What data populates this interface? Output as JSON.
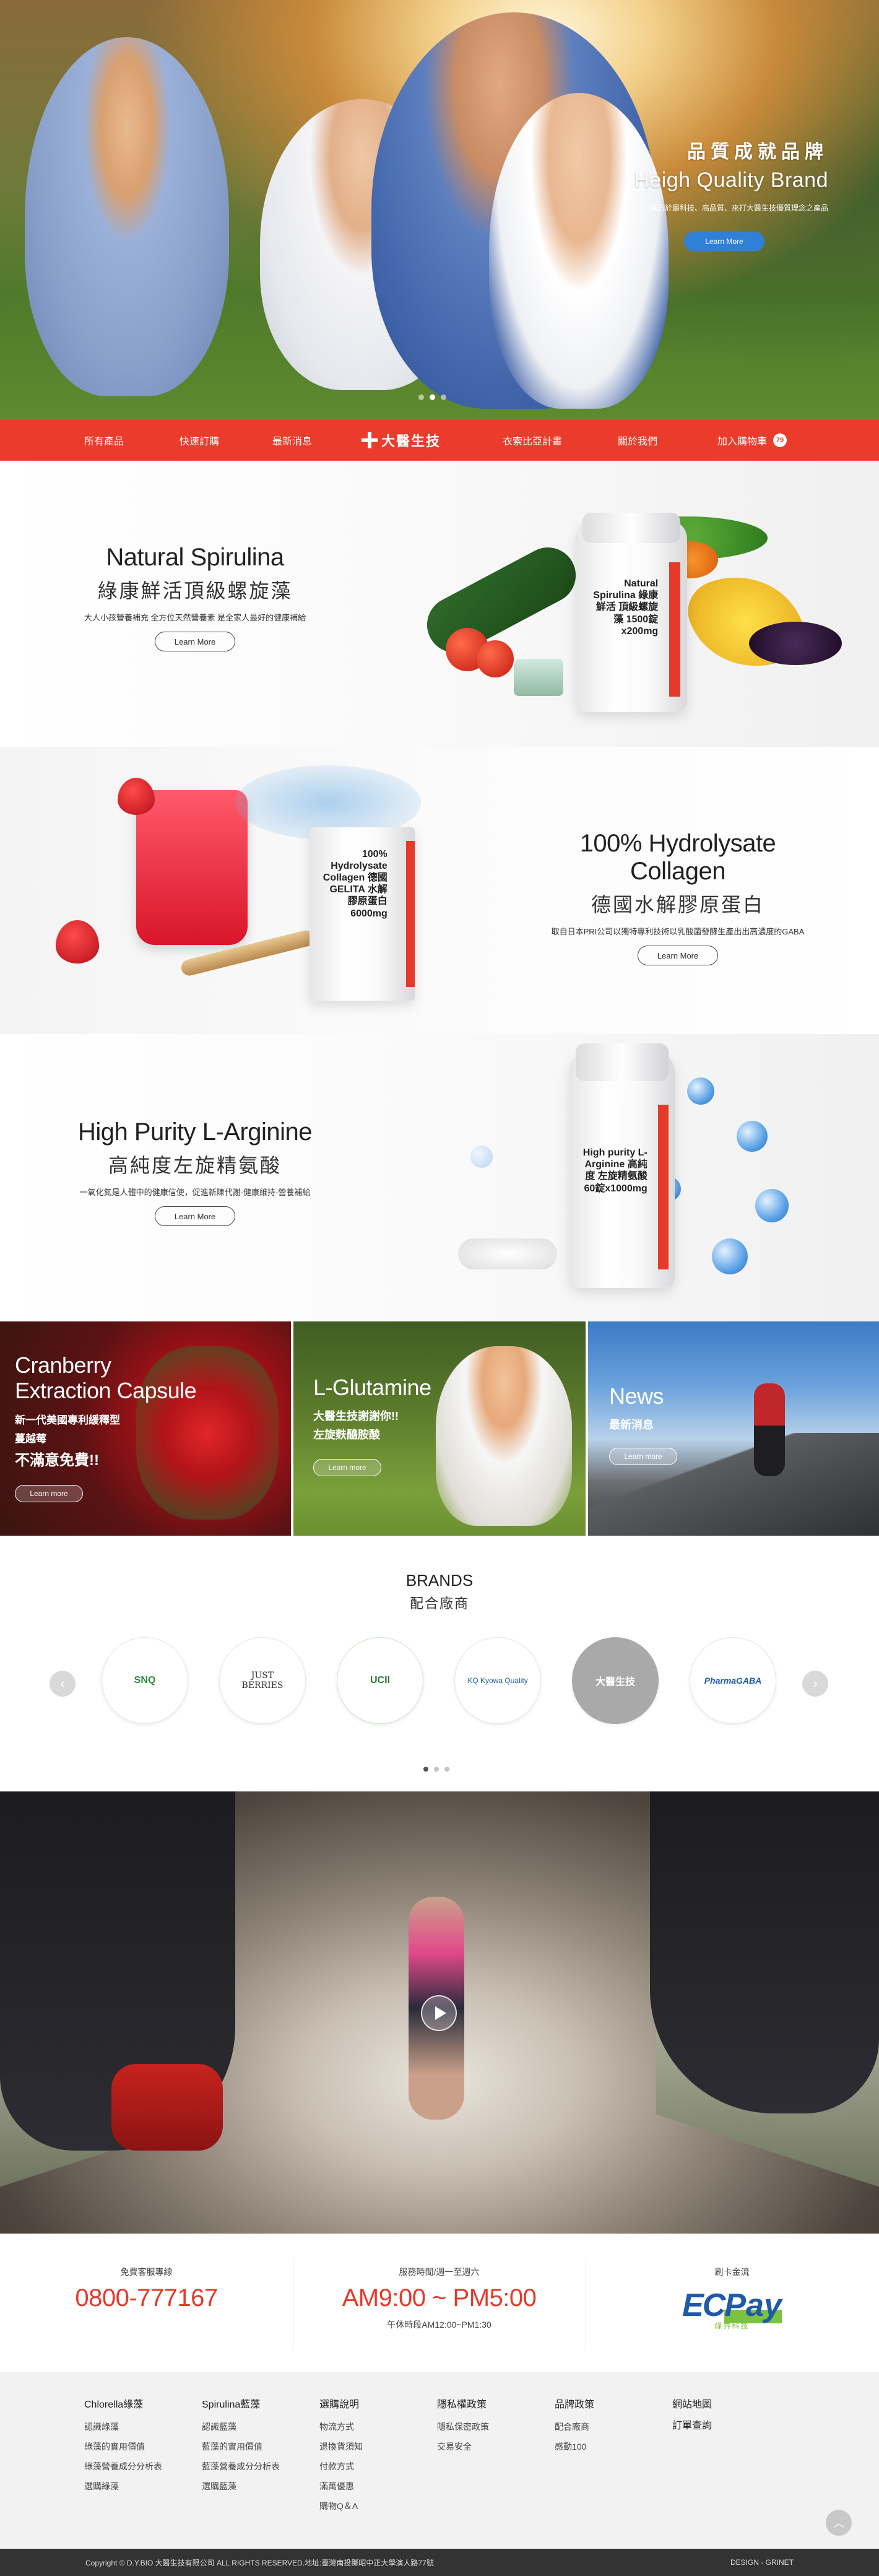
{
  "hero": {
    "title_zh": "品質成就品牌",
    "title_en": "Heigh Quality Brand",
    "subtitle": "專方於最科技、高品質、來打大醫生技優質理念之產品",
    "button": "Learn More"
  },
  "nav": {
    "items": [
      "所有產品",
      "快速訂購",
      "最新消息",
      "衣索比亞計畫",
      "關於我們",
      "加入購物車"
    ],
    "logo_text": "大醫生技",
    "cart_count": "79"
  },
  "products": [
    {
      "title_en": "Natural Spirulina",
      "title_zh": "綠康鮮活頂級螺旋藻",
      "desc": "大人小孩營養補充 全方位天然營養素 是全家人最好的健康補給",
      "button": "Learn More",
      "bottle_label": "Natural Spirulina 綠康鮮活 頂級螺旋藻 1500錠x200mg"
    },
    {
      "title_en": "100% Hydrolysate Collagen",
      "title_zh": "德國水解膠原蛋白",
      "desc": "取自日本PRI公司以獨特專利技術以乳酸菌發酵生產出出高濃度的GABA",
      "button": "Learn More",
      "bottle_label": "100% Hydrolysate Collagen 德國GELITA 水解膠原蛋白 6000mg"
    },
    {
      "title_en": "High Purity L-Arginine",
      "title_zh": "高純度左旋精氨酸",
      "desc": "一氧化氮是人體中的健康信使，促進新陳代謝-健康維持-營養補給",
      "button": "Learn More",
      "bottle_label": "High purity L-Arginine 高純度 左旋精氨酸 60錠x1000mg"
    }
  ],
  "tiles": [
    {
      "title": "Cranberry Extraction Capsule",
      "sub1": "新一代美國專利緩釋型",
      "sub2": "蔓越莓",
      "sub3": "不滿意免費!!",
      "button": "Learn more"
    },
    {
      "title": "L-Glutamine",
      "sub1": "大醫生技謝謝你!!",
      "sub2": "左旋麩醯胺酸",
      "button": "Learn more"
    },
    {
      "title": "News",
      "sub1": "最新消息",
      "button": "Learn more"
    }
  ],
  "brands": {
    "title_en": "BRANDS",
    "title_zh": "配合廠商",
    "logos": [
      "SNQ",
      "JUST BERRIES",
      "UCII",
      "KQ Kyowa Quality",
      "大醫生技",
      "PharmaGABA"
    ]
  },
  "info": {
    "hotline_label": "免費客服專線",
    "hotline": "0800-777167",
    "hours_label": "服務時間/週一至週六",
    "hours": "AM9:00 ~ PM5:00",
    "lunch": "午休時段AM12:00~PM1:30",
    "card_label": "刷卡金流",
    "ecpay_ec": "EC",
    "ecpay_pay": "Pay",
    "ecpay_sub": "綠界科技"
  },
  "footer": {
    "columns": [
      {
        "heading": "Chlorella綠藻",
        "links": [
          "認識綠藻",
          "綠藻的實用價值",
          "綠藻營養成分分析表",
          "選購綠藻"
        ]
      },
      {
        "heading": "Spirulina藍藻",
        "links": [
          "認識藍藻",
          "藍藻的實用價值",
          "藍藻營養成分分析表",
          "選購藍藻"
        ]
      },
      {
        "heading": "選購說明",
        "links": [
          "物流方式",
          "退換貨須知",
          "付款方式",
          "滿萬優惠",
          "購物Q＆A"
        ]
      },
      {
        "heading": "隱私權政策",
        "links": [
          "隱私保密政策",
          "交易安全"
        ]
      },
      {
        "heading": "品牌政策",
        "links": [
          "配合廠商",
          "感動100"
        ]
      },
      {
        "heading": "網站地圖",
        "links": [
          "訂單查詢"
        ]
      }
    ],
    "copyright": "Copyright © D.Y.BIO 大醫生技有限公司 ALL RIGHTS RESERVED.地址:臺灣南投縣昭中正大學演人路77號",
    "credit": "DESIGN - GRINET"
  },
  "colors": {
    "brand_red": "#ea3b2b",
    "hero_button": "#2f80d6",
    "ecpay_blue": "#1f5aa8",
    "ecpay_green": "#7cc241"
  }
}
